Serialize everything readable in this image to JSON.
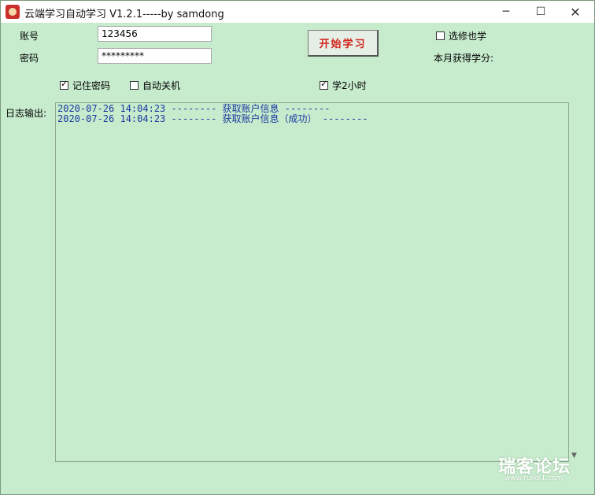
{
  "window": {
    "title": "云端学习自动学习 V1.2.1-----by samdong",
    "minimize_glyph": "─",
    "maximize_glyph": "☐",
    "close_glyph": "✕"
  },
  "form": {
    "account_label": "账号",
    "account_value": "123456",
    "password_label": "密码",
    "password_value": "*********",
    "start_button": "开始学习",
    "elective_label": "选修也学",
    "elective_checked": false,
    "monthly_credits_label": "本月获得学分:",
    "remember_password_label": "记住密码",
    "remember_password_checked": true,
    "auto_shutdown_label": "自动关机",
    "auto_shutdown_checked": false,
    "study_2h_label": "学2小时",
    "study_2h_checked": true
  },
  "log": {
    "label": "日志输出:",
    "lines": [
      "2020-07-26 14:04:23 -------- 获取账户信息 --------",
      "2020-07-26 14:04:23 -------- 获取账户信息（成功） --------"
    ]
  },
  "watermark": {
    "text": "瑞客论坛",
    "url": "www.ruike1.com"
  },
  "icons": [
    "app-icon",
    "minimize-icon",
    "maximize-icon",
    "close-icon",
    "checkbox-icon",
    "scroll-down-arrow-icon"
  ]
}
